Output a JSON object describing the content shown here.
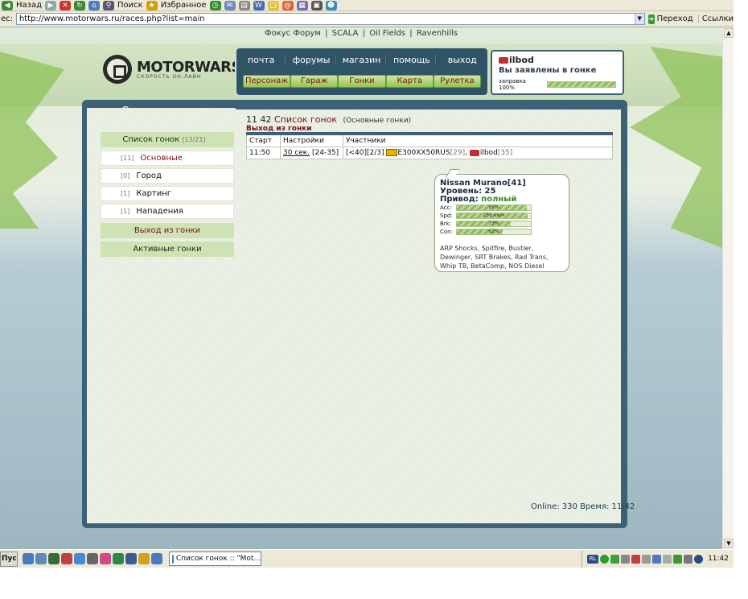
{
  "browser": {
    "toolbar": {
      "back_label": "Назад",
      "favorites_label": "Избранное",
      "search_label": "Поиск"
    },
    "address": {
      "label": "ес:",
      "url": "http://www.motorwars.ru/races.php?list=main",
      "go_label": "Переход",
      "links_label": "Ссылки"
    }
  },
  "site": {
    "top_links": [
      "Фокус Форум",
      "SCALA",
      "Oil Fields",
      "Ravenhills"
    ],
    "logo": {
      "name": "MOTORWARS.RU",
      "tagline": "СКОРОСТЬ ОН-ЛАЙН"
    },
    "nav_top": [
      "почта",
      "форумы",
      "магазин",
      "помощь",
      "выход"
    ],
    "nav_buttons": [
      "Персонаж",
      "Гараж",
      "Гонки",
      "Карта",
      "Рулетка"
    ],
    "user": {
      "name": "ilbod",
      "status": "Вы заявлены в гонке",
      "fuel_label": "заправка 100%",
      "fuel_fraction": 1.0
    }
  },
  "sidebar": {
    "title": "Список гонок",
    "header": {
      "label": "Список гонок",
      "count": "[13/21]"
    },
    "items": [
      {
        "count": "[11]",
        "label": "Основные"
      },
      {
        "count": "[0]",
        "label": "Город"
      },
      {
        "count": "[1]",
        "label": "Картинг"
      },
      {
        "count": "[1]",
        "label": "Нападения"
      }
    ],
    "exit_label": "Выход из гонки",
    "active_label": "Активные гонки"
  },
  "content": {
    "time": "11 42",
    "title": "Список гонок",
    "subtitle": "(Основные гонки)",
    "exit_link": "Выход из гонки",
    "table": {
      "headers": [
        "Старт",
        "Настройки",
        "Участники"
      ],
      "rows": [
        {
          "start": "11:50",
          "settings_link": "30 сек.",
          "settings_range": "[24-35]",
          "limit": "[<40]",
          "slots": "[2/3]",
          "p1_name": "E300XX50RUS",
          "p1_level": "[29]",
          "sep": ",",
          "p2_name": "ilbod",
          "p2_level": "[35]"
        }
      ]
    },
    "tooltip": {
      "car": "Nissan Murano[41]",
      "level": "Уровень: 25",
      "drive_label": "Привод:",
      "drive_value": "полный",
      "stats": [
        {
          "key": "Acc:",
          "label": "95%",
          "value": 0.95
        },
        {
          "key": "Spd:",
          "label": "256 км/ч",
          "value": 0.96
        },
        {
          "key": "Brk:",
          "label": "73%",
          "value": 0.73
        },
        {
          "key": "Con:",
          "label": "62%",
          "value": 0.62
        }
      ],
      "parts": "ARP Shocks, Spitfire, Bustler, Dewinger, SRT Brakes, Rad Trans, Whip TB, BetaComp, NOS Diesel"
    },
    "online": "Online: 330  Время: 11:42"
  },
  "taskbar": {
    "start_label": "Пуск",
    "task_label": "Список гонок :: \"Mot...",
    "lang": "RL",
    "clock": "11:42"
  }
}
